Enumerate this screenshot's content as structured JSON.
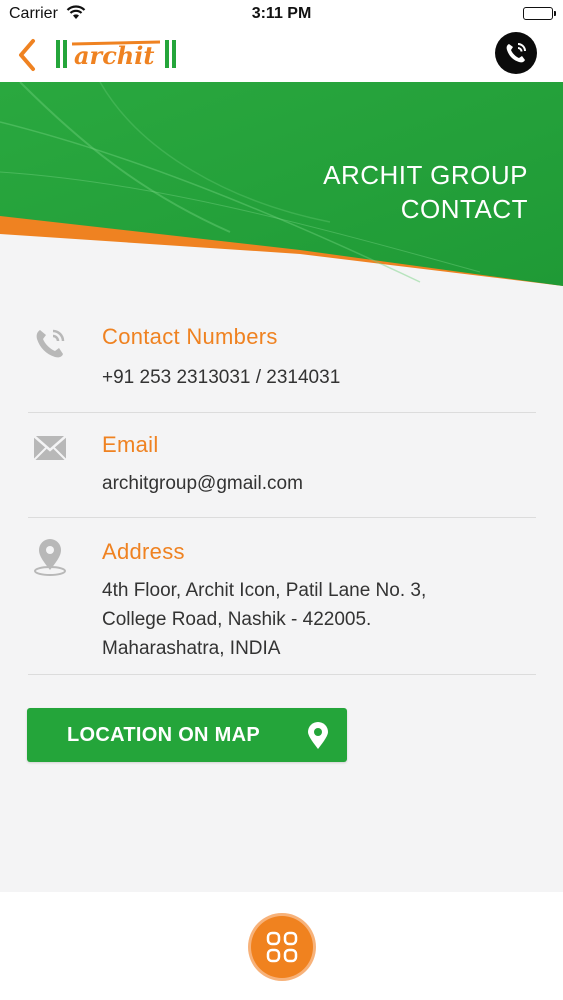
{
  "status_bar": {
    "carrier": "Carrier",
    "time": "3:11 PM"
  },
  "nav": {
    "back_icon": "chevron-left-icon",
    "logo_text": "archit",
    "call_icon": "phone-call-icon"
  },
  "banner": {
    "title_line1": "ARCHIT GROUP",
    "title_line2": "CONTACT"
  },
  "contact": {
    "label": "Contact Numbers",
    "value": "+91 253 2313031 / 2314031",
    "icon": "phone-icon"
  },
  "email": {
    "label": "Email",
    "value": "architgroup@gmail.com",
    "icon": "mail-icon"
  },
  "address": {
    "label": "Address",
    "lines": [
      "4th Floor, Archit Icon, Patil Lane No. 3,",
      "College Road, Nashik - 422005.",
      "Maharashatra, INDIA"
    ],
    "icon": "location-pin-icon"
  },
  "map_button": {
    "label": "LOCATION ON MAP",
    "icon": "map-pin-icon"
  },
  "bottom": {
    "menu_icon": "grid-menu-icon"
  },
  "colors": {
    "accent_green": "#24a53a",
    "accent_orange": "#ef8221",
    "background": "#f4f4f5"
  }
}
